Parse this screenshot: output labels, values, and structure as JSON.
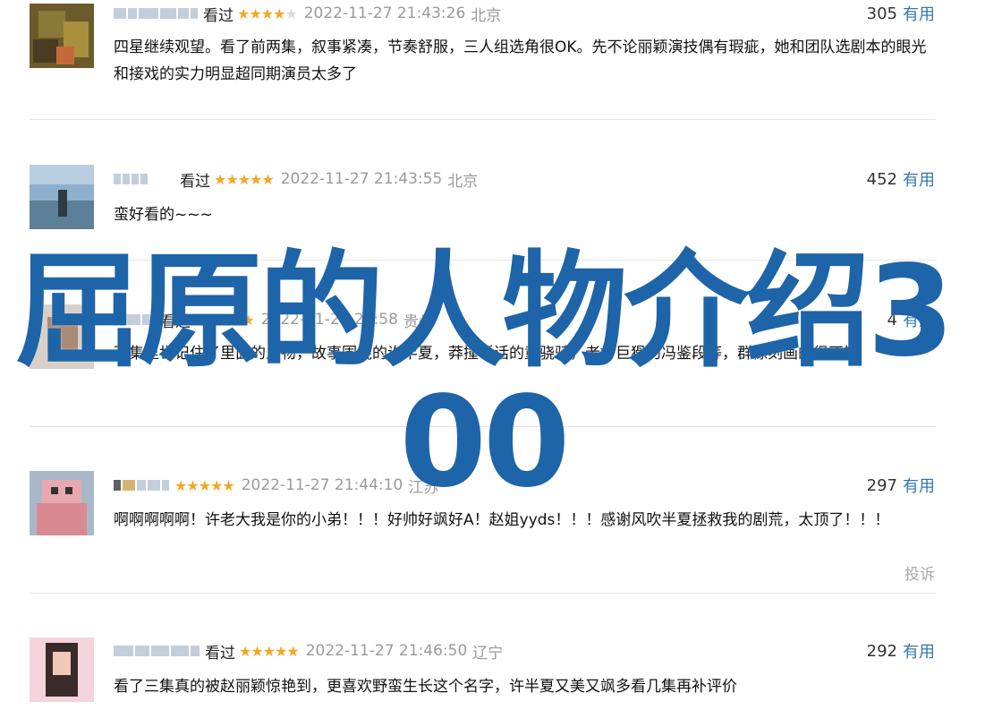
{
  "overlay_title": "屈原的人物介绍3\n00",
  "comments": [
    {
      "watched": "看过",
      "rating": 4,
      "time": "2022-11-27 21:43:26",
      "location": "北京",
      "votes": "305",
      "useful": "有用",
      "text": "四星继续观望。看了前两集，叙事紧凑，节奏舒服，三人组选角很OK。先不论丽颖演技偶有瑕疵，她和团队选剧本的眼光和接戏的实力明显超同期演员太多了"
    },
    {
      "watched": "看过",
      "rating": 5,
      "time": "2022-11-27 21:43:55",
      "location": "北京",
      "votes": "452",
      "useful": "有用",
      "text": "蛮好看的~~~"
    },
    {
      "watched": "看过",
      "rating": 5,
      "time": "2022-11-27 21:58",
      "location": "贵州",
      "votes": "4",
      "useful": "有用",
      "text": "西集里世记住了里面的人物，故事围绕的许半夏，莽撞听话的童骁骑，老好巨猾的冯鉴段等，群像刻画的很不错"
    },
    {
      "watched": "",
      "rating": 5,
      "time": "2022-11-27 21:44:10",
      "location": "江苏",
      "votes": "297",
      "useful": "有用",
      "text": "啊啊啊啊啊！许老大我是你的小弟！！！好帅好飒好A！赵姐yyds！！！感谢风吹半夏拯救我的剧荒，太顶了！！！",
      "report": "投诉"
    },
    {
      "watched": "看过",
      "rating": 5,
      "time": "2022-11-27 21:46:50",
      "location": "辽宁",
      "votes": "292",
      "useful": "有用",
      "text": "看了三集真的被赵丽颖惊艳到，更喜欢野蛮生长这个名字，许半夏又美又飒多看几集再补评价"
    }
  ],
  "colors": {
    "accent_link": "#3377aa",
    "star": "#f5a623",
    "overlay": "#1e64a8",
    "meta_gray": "#9a9a9a"
  }
}
